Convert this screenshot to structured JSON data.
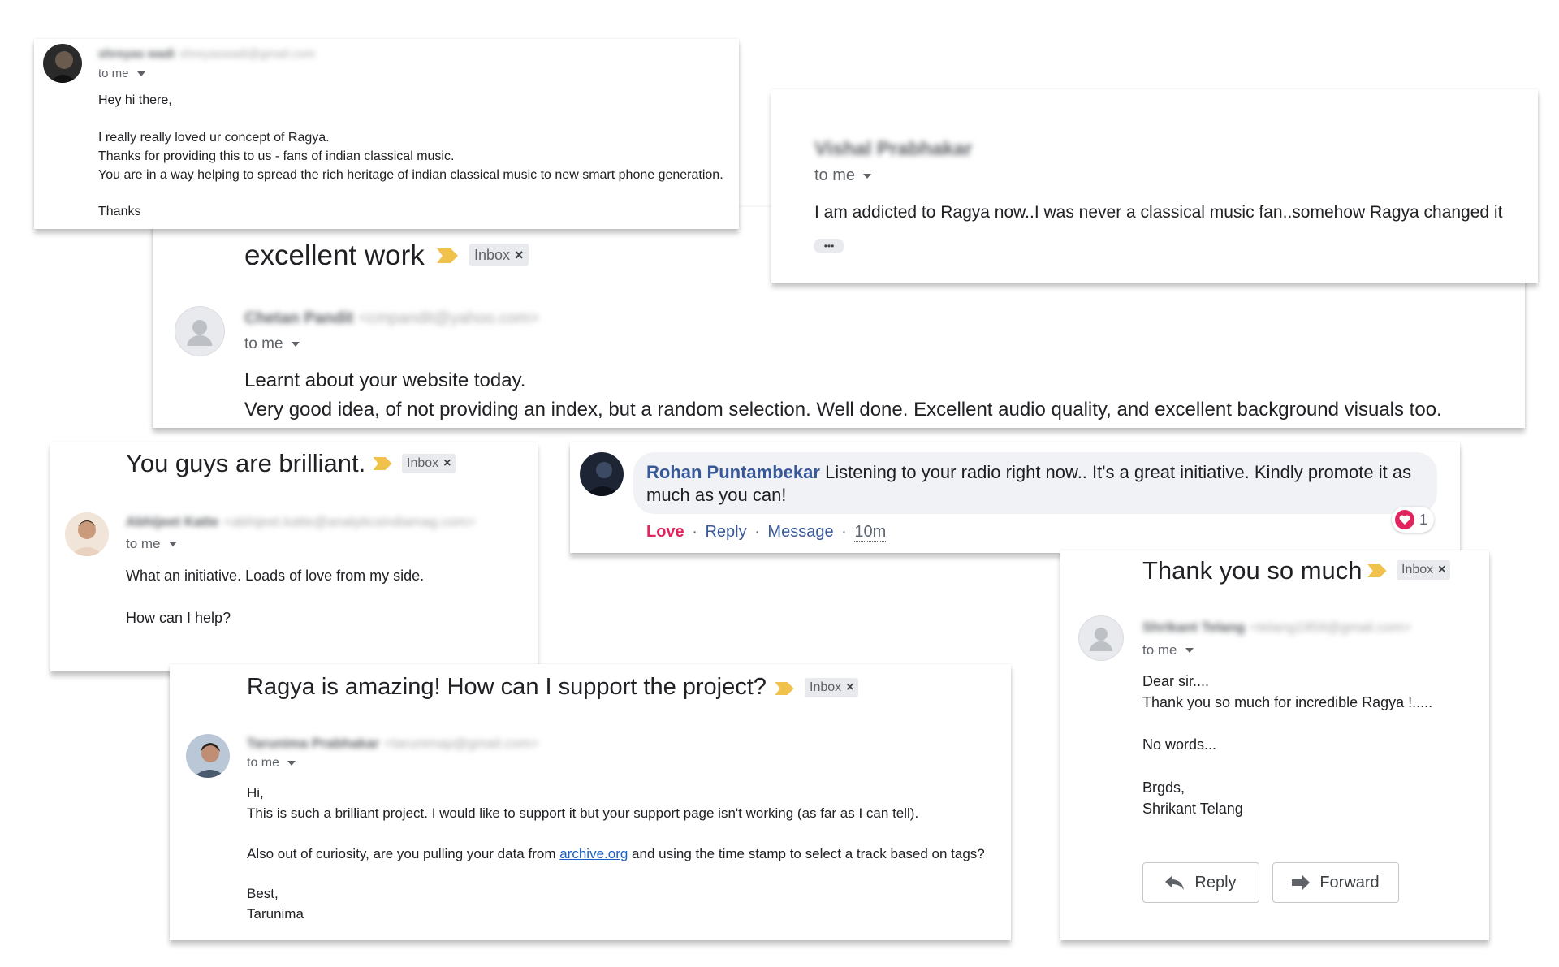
{
  "email1": {
    "sender_name": "shreyas wadi",
    "sender_email": "shreyaswadi@gmail.com",
    "to_me": "to me",
    "lines": [
      "Hey hi there,",
      "I really really loved ur concept of Ragya.",
      "Thanks for providing this to us - fans of indian classical music.",
      "You are in a way helping to spread the rich heritage of indian classical music to new smart phone generation.",
      "Thanks"
    ]
  },
  "email2": {
    "sender_name": "Vishal Prabhakar",
    "to_me": "to me",
    "body": "I am addicted to Ragya now..I was never a classical music fan..somehow Ragya changed it",
    "ellipsis": "•••"
  },
  "email3": {
    "subject": "excellent work",
    "label": "Inbox",
    "sender_name": "Chetan Pandit",
    "sender_email": "<cmpandit@yahoo.com>",
    "to_me": "to me",
    "lines": [
      "Learnt about your website today.",
      "Very good idea, of not providing an index, but a random selection. Well done. Excellent audio quality, and excellent background visuals too."
    ]
  },
  "email4": {
    "subject": "You guys are brilliant.",
    "label": "Inbox",
    "sender_name": "Abhijeet Katte",
    "sender_email": "<abhijeet.katte@analyticsindiamag.com>",
    "to_me": "to me",
    "lines": [
      "What an initiative. Loads of love from my side.",
      "How can I help?"
    ]
  },
  "comment": {
    "author": "Rohan Puntambekar",
    "text": "Listening to your radio right now.. It's a great initiative. Kindly promote it as much as you can!",
    "actions": {
      "love": "Love",
      "sep": "·",
      "reply": "Reply",
      "message": "Message",
      "time": "10m"
    },
    "reaction_count": "1",
    "reaction_color": "#e0245e"
  },
  "email5": {
    "subject": "Thank you so much",
    "label": "Inbox",
    "sender_name": "Shrikant Telang",
    "sender_email": "<telang1959@gmail.com>",
    "to_me": "to me",
    "lines": [
      "Dear sir....",
      "Thank you so much for incredible Ragya !.....",
      "No words...",
      "Brgds,",
      "Shrikant Telang"
    ],
    "reply_label": "Reply",
    "forward_label": "Forward"
  },
  "email6": {
    "subject": "Ragya is amazing! How can I support the project?",
    "label": "Inbox",
    "sender_name": "Tarunima Prabhakar",
    "sender_email": "<tarunimap@gmail.com>",
    "to_me": "to me",
    "line1": "Hi,",
    "line2": "This is such a brilliant project. I would like to support it but your support page isn't working (as far as I can tell).",
    "line3_before": "Also out of curiosity, are you pulling your data from ",
    "line3_link": "archive.org",
    "line3_after": " and using the time stamp to select a track based on tags?",
    "line4": "Best,",
    "line5": "Tarunima"
  },
  "colors": {
    "importance_marker": "#f0c14b",
    "link": "#1a5fc8",
    "comment_author": "#385898",
    "love": "#e0245e"
  }
}
